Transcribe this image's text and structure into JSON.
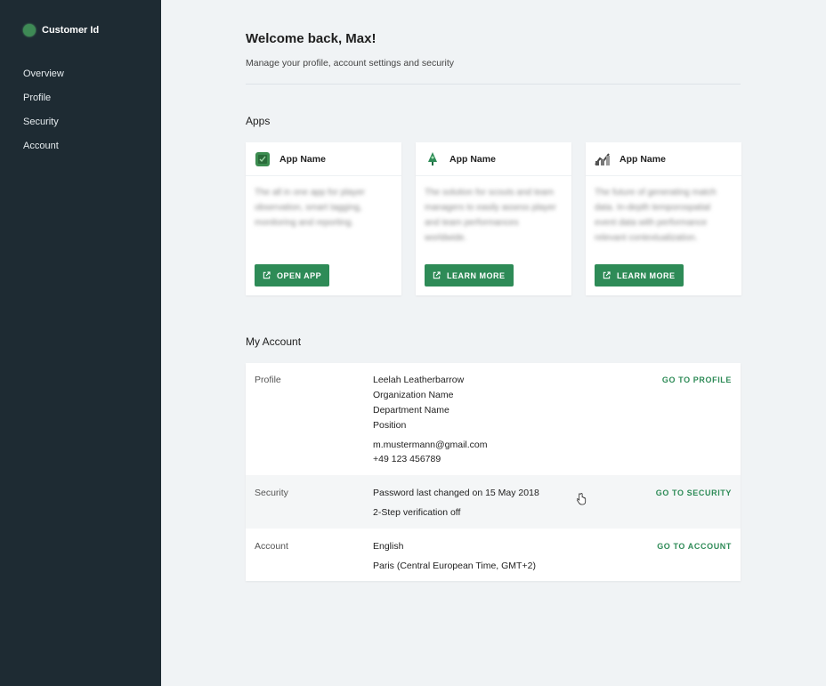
{
  "sidebar": {
    "brand": "Customer Id",
    "items": [
      {
        "label": "Overview"
      },
      {
        "label": "Profile"
      },
      {
        "label": "Security"
      },
      {
        "label": "Account"
      }
    ]
  },
  "header": {
    "title": "Welcome back, Max!",
    "subtitle": "Manage your profile, account settings and security"
  },
  "apps": {
    "title": "Apps",
    "cards": [
      {
        "name": "App Name",
        "icon": "tagging-app-icon",
        "description": "The all in one app for player observation, smart tagging, monitoring and reporting.",
        "button": "OPEN APP"
      },
      {
        "name": "App Name",
        "icon": "scouting-app-icon",
        "description": "The solution for scouts and team managers to easily assess player and team performances worldwide.",
        "button": "LEARN MORE"
      },
      {
        "name": "App Name",
        "icon": "data-app-icon",
        "description": "The future of generating match data. In-depth temporospatial event data with performance relevant contextualization.",
        "button": "LEARN MORE"
      }
    ]
  },
  "my_account": {
    "title": "My Account",
    "profile": {
      "label": "Profile",
      "name": "Leelah Leatherbarrow",
      "organization": "Organization Name",
      "department": "Department Name",
      "position": "Position",
      "email": "m.mustermann@gmail.com",
      "phone": "+49 123 456789",
      "link": "GO TO PROFILE"
    },
    "security": {
      "label": "Security",
      "password": "Password last changed on 15 May 2018",
      "two_step": "2-Step verification off",
      "link": "GO TO SECURITY"
    },
    "account": {
      "label": "Account",
      "language": "English",
      "timezone": "Paris (Central European Time, GMT+2)",
      "link": "GO TO ACCOUNT"
    }
  },
  "colors": {
    "sidebar_bg": "#1e2b33",
    "accent": "#2e8b57",
    "page_bg": "#f0f3f5"
  }
}
